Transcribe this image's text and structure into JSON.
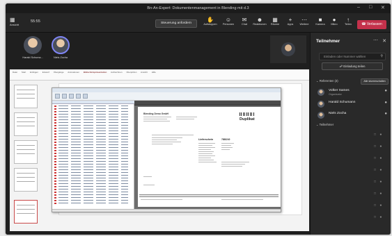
{
  "window": {
    "title": "Bn-An-Expert: Dokumentenmanagement in Blending mit d.3",
    "controls": [
      "–",
      "□",
      "✕"
    ]
  },
  "toolbar": {
    "left_label": "Ansicht",
    "timer": "55:55",
    "control_button": "Steuerung anfordern",
    "items": [
      {
        "label": "Aufstoppen",
        "icon": "raise-hand-icon",
        "glyph": "✋"
      },
      {
        "label": "Personen",
        "icon": "people-icon",
        "glyph": "☺"
      },
      {
        "label": "Chat",
        "icon": "chat-icon",
        "glyph": "✉"
      },
      {
        "label": "Reaktionen",
        "icon": "reaction-icon",
        "glyph": "☻"
      },
      {
        "label": "Räume",
        "icon": "rooms-icon",
        "glyph": "▦"
      },
      {
        "label": "Apps",
        "icon": "apps-icon",
        "glyph": "+"
      },
      {
        "label": "Weitere",
        "icon": "more-icon",
        "glyph": "⋯"
      },
      {
        "label": "Kamera",
        "icon": "camera-icon",
        "glyph": "■"
      },
      {
        "label": "Mikro",
        "icon": "mic-icon",
        "glyph": "●"
      },
      {
        "label": "Teilen",
        "icon": "share-icon",
        "glyph": "↑"
      }
    ],
    "leave_button": "Verlassen"
  },
  "stage": {
    "participants": [
      {
        "name": "Harald Schuma..."
      },
      {
        "name": "Niels Zocha"
      }
    ]
  },
  "shared_screen": {
    "ribbon_tabs": [
      "Datei",
      "Start",
      "Einfügen",
      "Entwurf",
      "Übergänge",
      "Animationen",
      "Bildschirmpräsentation",
      "Aufzeichnen",
      "Überprüfen",
      "Ansicht",
      "Hilfe"
    ],
    "active_tab": "Bildschirmpräsentation",
    "document": {
      "company": "Blending Demo GmbH",
      "title": "Duplikat",
      "doc_type": "Lieferschein",
      "doc_number": "7888240"
    }
  },
  "panel": {
    "title": "Teilnehmer",
    "invite_placeholder": "Einladen oder Nummer wählen",
    "share_invite": "Einladung teilen",
    "section_in_meeting": "Referenten (3)",
    "mute_all": "Alle stummschalten",
    "people": [
      {
        "name": "Volker Sames",
        "role": "Organisator"
      },
      {
        "name": "Harald Schumann",
        "role": ""
      },
      {
        "name": "Niels Zocha",
        "role": ""
      }
    ],
    "section_attendees": "Teilnehmer"
  }
}
